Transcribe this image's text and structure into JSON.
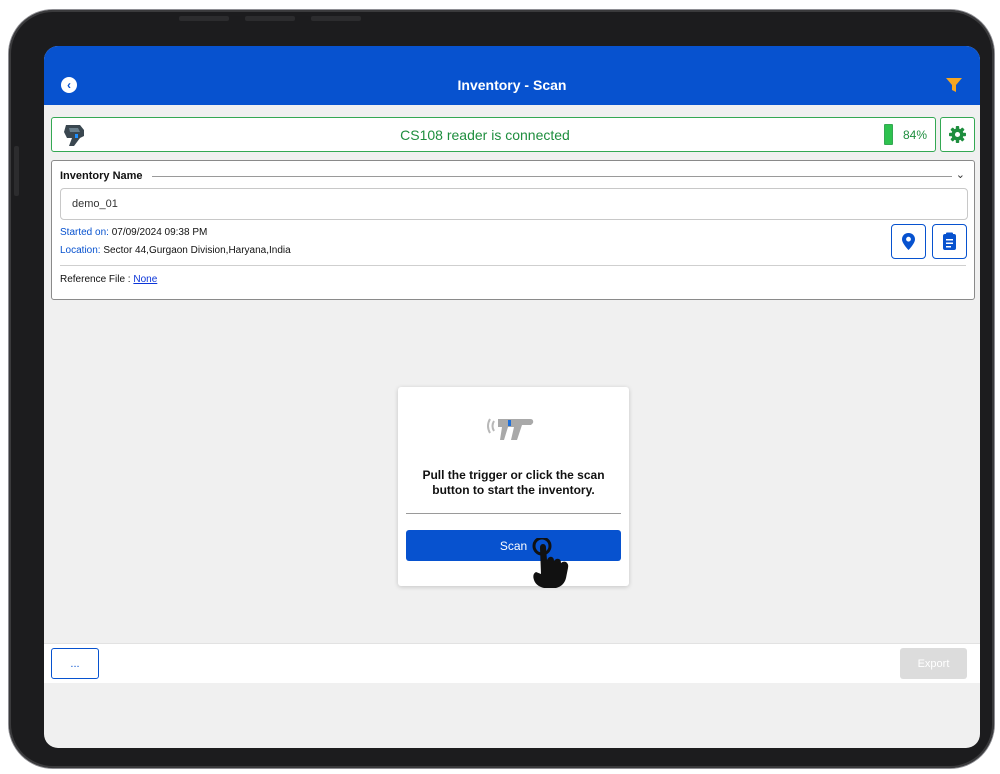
{
  "header": {
    "title": "Inventory - Scan",
    "back_icon": "chevron-left-circle-icon",
    "filter_icon": "filter-icon"
  },
  "reader": {
    "status": "CS108 reader is connected",
    "battery_percent": "84%",
    "battery_level": 0.84,
    "status_color": "#1e8e3e"
  },
  "inventory": {
    "name_label": "Inventory Name",
    "name_value": "demo_01",
    "started_label": "Started on:",
    "started_value": "07/09/2024 09:38 PM",
    "location_label": "Location:",
    "location_value": "Sector 44,Gurgaon Division,Haryana,India",
    "reference_label": "Reference File :",
    "reference_value": "None"
  },
  "scan_card": {
    "message": "Pull the trigger or click the scan button to start the inventory.",
    "scan_label": "Scan"
  },
  "footer": {
    "more_label": "...",
    "export_label": "Export"
  },
  "colors": {
    "primary": "#0752cf",
    "connected": "#34a853",
    "filter": "#f5a623"
  }
}
